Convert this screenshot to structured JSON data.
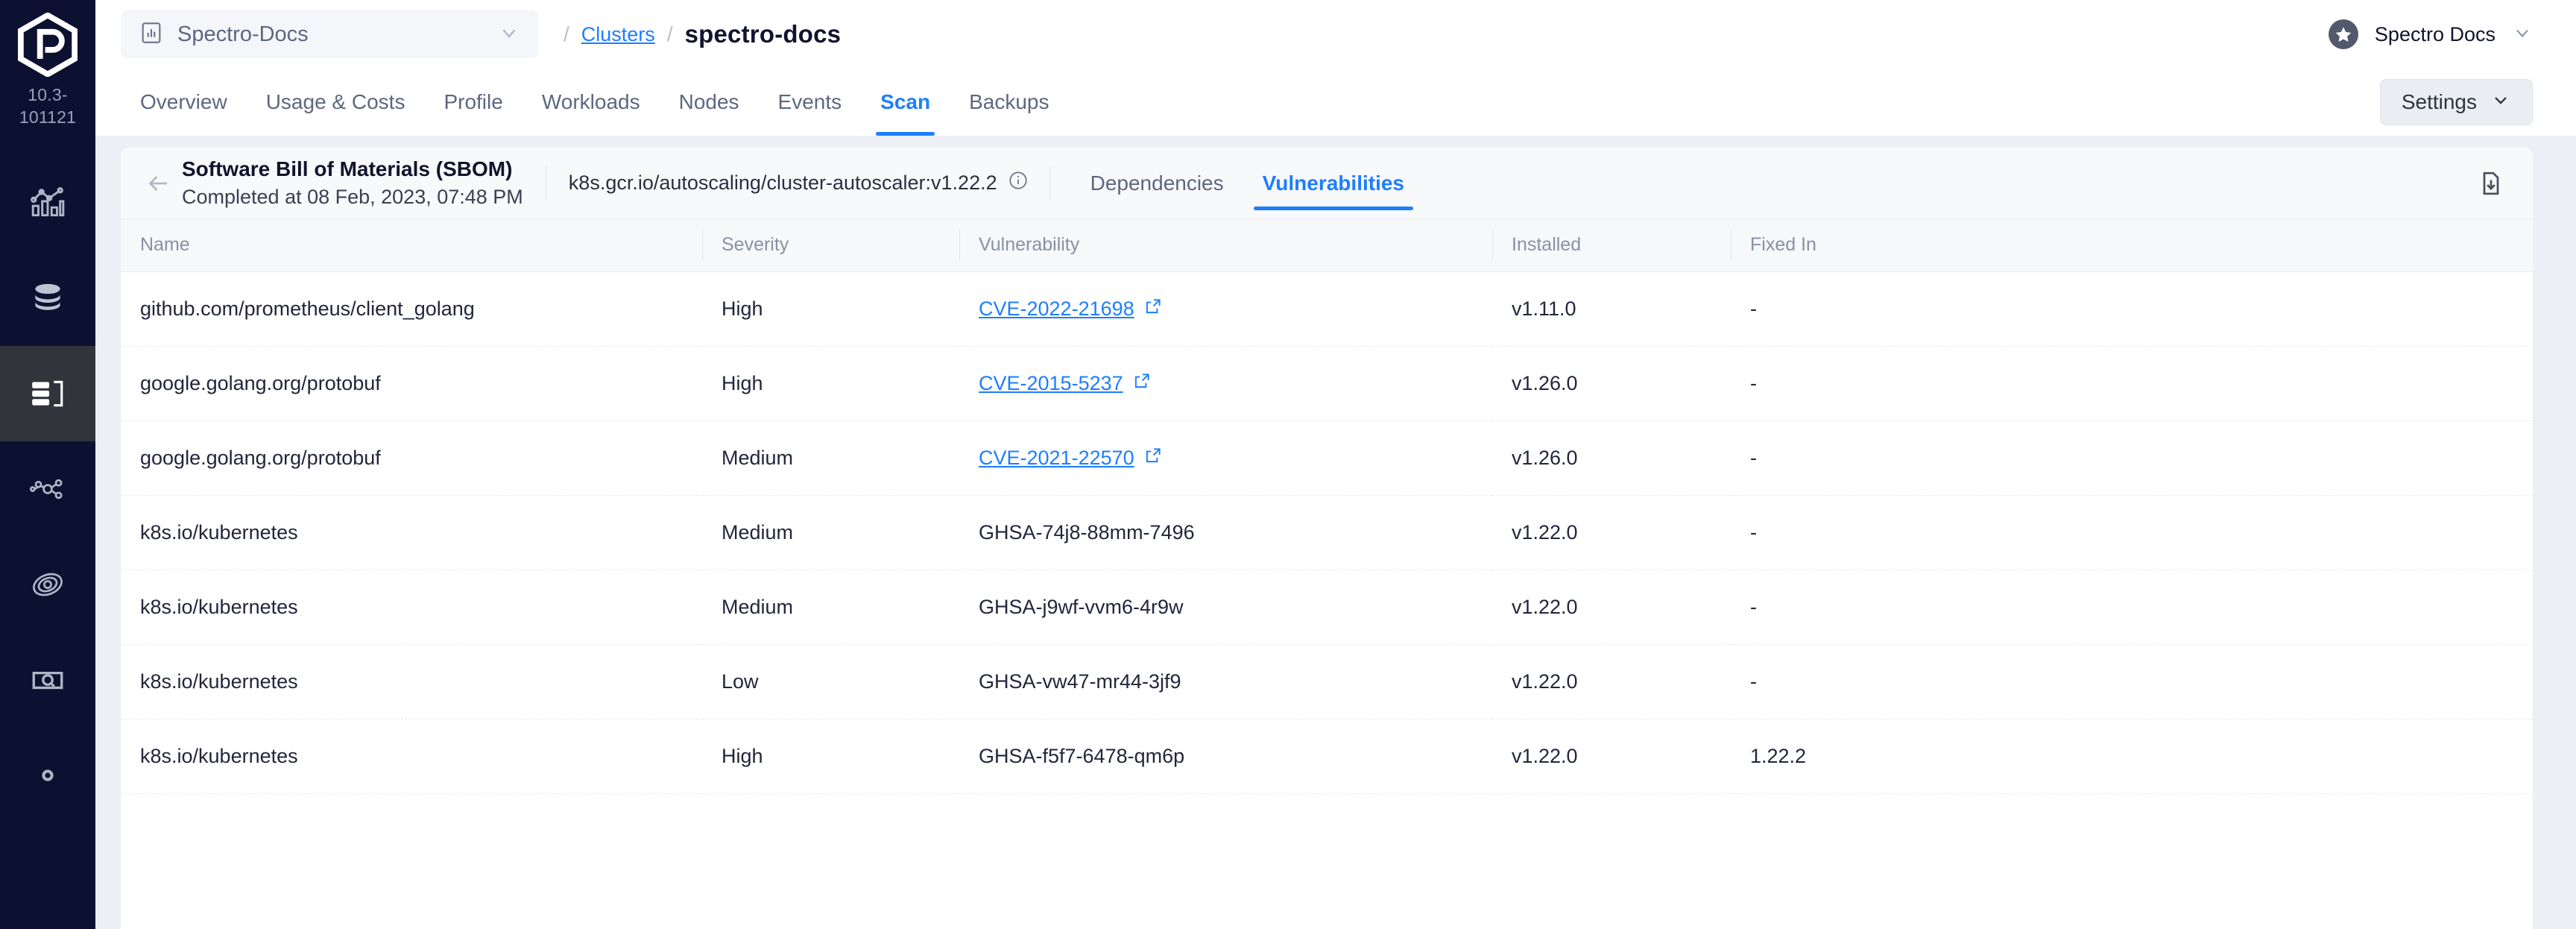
{
  "sidebar": {
    "brand_icon": "spectro-cloud-logo",
    "version": "10.3-101121",
    "items": [
      {
        "name": "dashboard",
        "icon": "chart-bars-icon",
        "active": false
      },
      {
        "name": "projects",
        "icon": "database-stack-icon",
        "active": false
      },
      {
        "name": "clusters",
        "icon": "server-rack-icon",
        "active": true
      },
      {
        "name": "cluster-profiles",
        "icon": "node-graph-icon",
        "active": false
      },
      {
        "name": "packs-registries",
        "icon": "orbit-icon",
        "active": false
      },
      {
        "name": "audit-logs",
        "icon": "search-doc-icon",
        "active": false
      },
      {
        "name": "settings",
        "icon": "gear-icon",
        "active": false
      }
    ]
  },
  "topbar": {
    "project_selector": {
      "icon": "chart-square-icon",
      "label": "Spectro-Docs",
      "caret": "chevron-down-icon"
    },
    "breadcrumb": {
      "sep": "/",
      "link": "Clusters",
      "current": "spectro-docs"
    },
    "user": {
      "badge_icon": "star-icon",
      "name": "Spectro Docs",
      "caret": "chevron-down-icon"
    }
  },
  "tabs": [
    {
      "label": "Overview",
      "active": false
    },
    {
      "label": "Usage & Costs",
      "active": false
    },
    {
      "label": "Profile",
      "active": false
    },
    {
      "label": "Workloads",
      "active": false
    },
    {
      "label": "Nodes",
      "active": false
    },
    {
      "label": "Events",
      "active": false
    },
    {
      "label": "Scan",
      "active": true
    },
    {
      "label": "Backups",
      "active": false
    }
  ],
  "settings_button": {
    "label": "Settings",
    "caret": "chevron-down-icon"
  },
  "panel": {
    "back_icon": "arrow-left-icon",
    "title": "Software Bill of Materials (SBOM)",
    "subtitle": "Completed at 08 Feb, 2023, 07:48 PM",
    "separator": "/",
    "image_ref": "k8s.gcr.io/autoscaling/cluster-autoscaler:v1.22.2",
    "info_icon": "info-circle-icon",
    "subtabs": [
      {
        "label": "Dependencies",
        "active": false
      },
      {
        "label": "Vulnerabilities",
        "active": true
      }
    ],
    "download_icon": "file-download-icon"
  },
  "table": {
    "columns": [
      "Name",
      "Severity",
      "Vulnerability",
      "Installed",
      "Fixed In"
    ],
    "rows": [
      {
        "name": "github.com/prometheus/client_golang",
        "severity": "High",
        "vulnerability": "CVE-2022-21698",
        "is_link": true,
        "installed": "v1.11.0",
        "fixed_in": "-"
      },
      {
        "name": "google.golang.org/protobuf",
        "severity": "High",
        "vulnerability": "CVE-2015-5237",
        "is_link": true,
        "installed": "v1.26.0",
        "fixed_in": "-"
      },
      {
        "name": "google.golang.org/protobuf",
        "severity": "Medium",
        "vulnerability": "CVE-2021-22570",
        "is_link": true,
        "installed": "v1.26.0",
        "fixed_in": "-"
      },
      {
        "name": "k8s.io/kubernetes",
        "severity": "Medium",
        "vulnerability": "GHSA-74j8-88mm-7496",
        "is_link": false,
        "installed": "v1.22.0",
        "fixed_in": "-"
      },
      {
        "name": "k8s.io/kubernetes",
        "severity": "Medium",
        "vulnerability": "GHSA-j9wf-vvm6-4r9w",
        "is_link": false,
        "installed": "v1.22.0",
        "fixed_in": "-"
      },
      {
        "name": "k8s.io/kubernetes",
        "severity": "Low",
        "vulnerability": "GHSA-vw47-mr44-3jf9",
        "is_link": false,
        "installed": "v1.22.0",
        "fixed_in": "-"
      },
      {
        "name": "k8s.io/kubernetes",
        "severity": "High",
        "vulnerability": "GHSA-f5f7-6478-qm6p",
        "is_link": false,
        "installed": "v1.22.0",
        "fixed_in": "1.22.2"
      }
    ]
  },
  "colors": {
    "accent": "#1d7eff",
    "sidebar_bg": "#0d1131",
    "content_bg": "#eceff3"
  }
}
